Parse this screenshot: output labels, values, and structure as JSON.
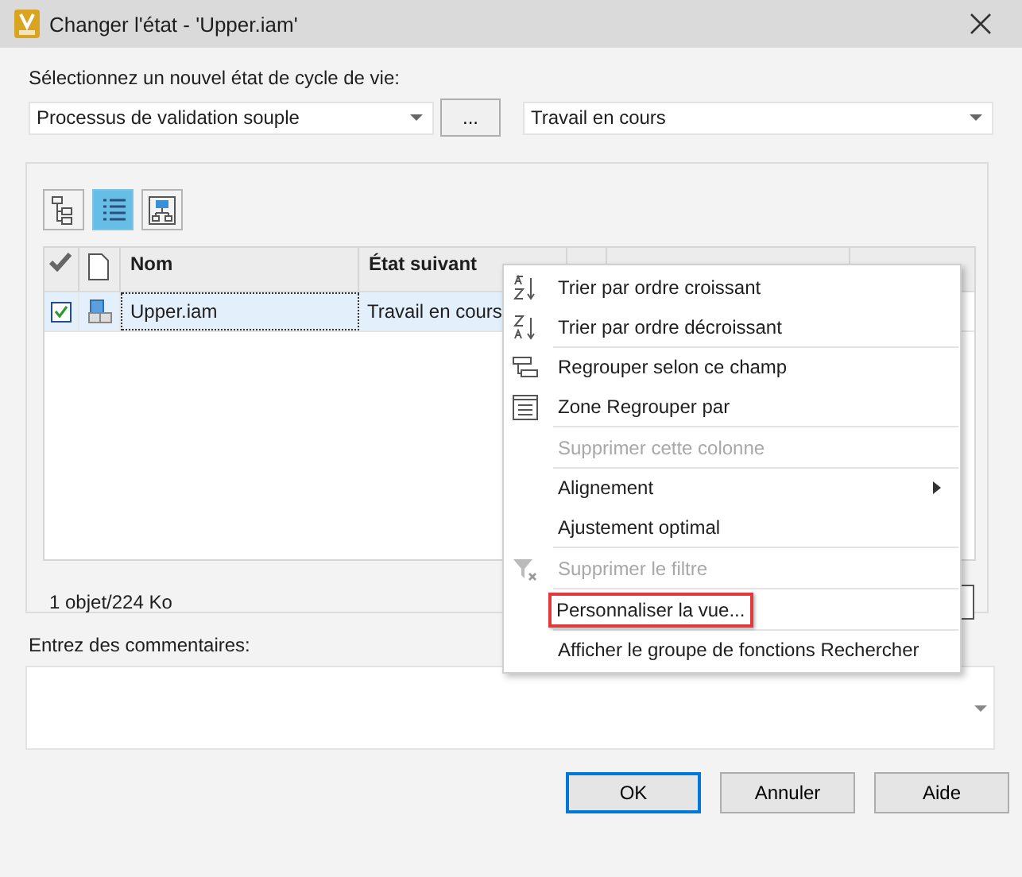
{
  "window": {
    "title": "Changer l'état - 'Upper.iam'"
  },
  "lifecycle": {
    "label": "Sélectionnez un nouvel état de cycle de vie:",
    "definition": "Processus de validation souple",
    "browse_button": "...",
    "state": "Travail en cours"
  },
  "view_buttons": [
    {
      "kind": "tree",
      "selected": false
    },
    {
      "kind": "list",
      "selected": true
    },
    {
      "kind": "diagram",
      "selected": false
    }
  ],
  "table": {
    "columns": [
      {
        "kind": "check"
      },
      {
        "kind": "file"
      },
      {
        "kind": "text",
        "label": "Nom"
      },
      {
        "kind": "text",
        "label": "État suivant"
      },
      {
        "kind": "sort"
      },
      {
        "kind": "text"
      }
    ],
    "rows": [
      {
        "checked": true,
        "selected": true,
        "name": "Upper.iam",
        "next_state": "Travail en cours"
      }
    ]
  },
  "status": "1 objet/224 Ko",
  "comments": {
    "label": "Entrez des commentaires:"
  },
  "buttons": [
    {
      "label": "OK",
      "default": true
    },
    {
      "label": "Annuler",
      "default": false
    },
    {
      "label": "Aide",
      "default": false
    }
  ],
  "context_menu": [
    {
      "label": "Trier par ordre croissant",
      "kind": "ascending",
      "disabled": false,
      "highlighted": false,
      "submenu": false,
      "separator_after": false
    },
    {
      "label": "Trier par ordre décroissant",
      "kind": "descending",
      "disabled": false,
      "highlighted": false,
      "submenu": false,
      "separator_after": true
    },
    {
      "label": "Regrouper selon ce champ",
      "kind": "group",
      "disabled": false,
      "highlighted": false,
      "submenu": false,
      "separator_after": false
    },
    {
      "label": "Zone Regrouper par",
      "kind": "groupbox",
      "disabled": false,
      "highlighted": false,
      "submenu": false,
      "separator_after": true
    },
    {
      "label": "Supprimer cette colonne",
      "kind": "plain",
      "disabled": true,
      "highlighted": false,
      "submenu": false,
      "separator_after": true
    },
    {
      "label": "Alignement",
      "kind": "plain",
      "disabled": false,
      "highlighted": false,
      "submenu": true,
      "separator_after": false
    },
    {
      "label": "Ajustement optimal",
      "kind": "plain",
      "disabled": false,
      "highlighted": false,
      "submenu": false,
      "separator_after": true
    },
    {
      "label": "Supprimer le filtre",
      "kind": "filter",
      "disabled": true,
      "highlighted": false,
      "submenu": false,
      "separator_after": true
    },
    {
      "label": "Personnaliser la vue...",
      "kind": "plain",
      "disabled": false,
      "highlighted": true,
      "submenu": false,
      "separator_after": true
    },
    {
      "label": "Afficher le groupe de fonctions Rechercher",
      "kind": "plain",
      "disabled": false,
      "highlighted": false,
      "submenu": false,
      "separator_after": false
    }
  ]
}
